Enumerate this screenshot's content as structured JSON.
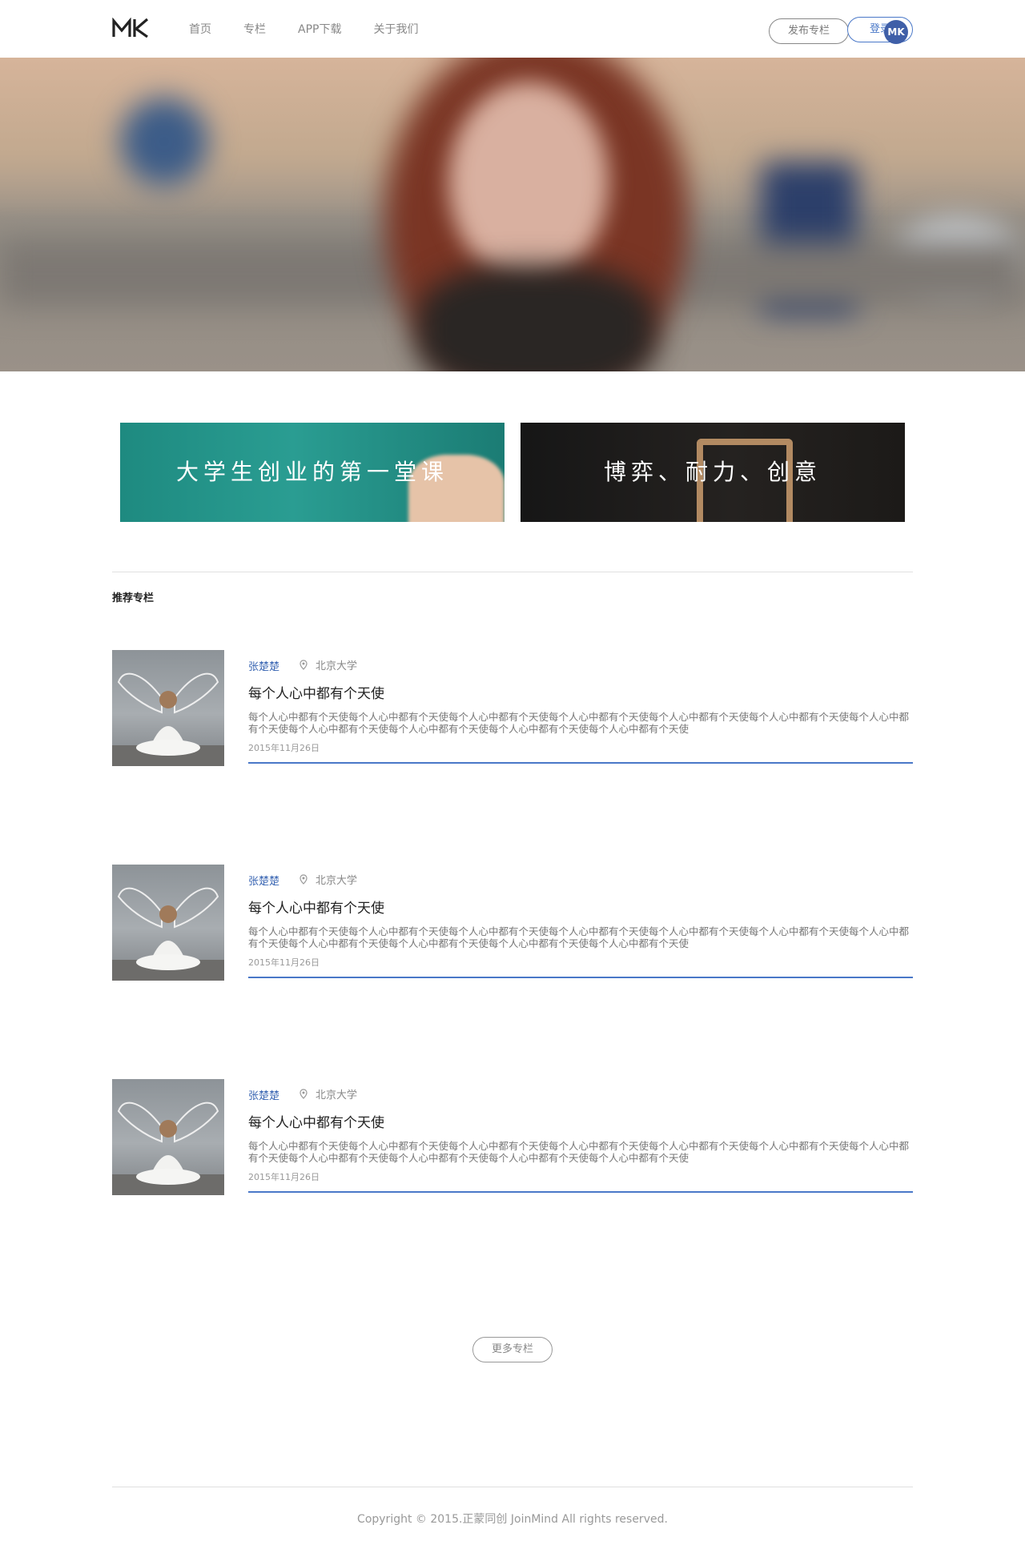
{
  "header": {
    "logo": "MK",
    "nav": [
      "首页",
      "专栏",
      "APP下载",
      "关于我们"
    ],
    "publish_label": "发布专栏",
    "login_label": "登录",
    "avatar_text": "MK",
    "accent_color": "#4a78c8"
  },
  "banners": [
    {
      "title": "大学生创业的第一堂课"
    },
    {
      "title": "博弈、耐力、创意"
    }
  ],
  "section": {
    "title": "推荐专栏"
  },
  "articles": [
    {
      "author": "张楚楚",
      "location": "北京大学",
      "title": "每个人心中都有个天使",
      "desc": "每个人心中都有个天使每个人心中都有个天使每个人心中都有个天使每个人心中都有个天使每个人心中都有个天使每个人心中都有个天使每个人心中都有个天使每个人心中都有个天使每个人心中都有个天使每个人心中都有个天使每个人心中都有个天使",
      "date": "2015年11月26日"
    },
    {
      "author": "张楚楚",
      "location": "北京大学",
      "title": "每个人心中都有个天使",
      "desc": "每个人心中都有个天使每个人心中都有个天使每个人心中都有个天使每个人心中都有个天使每个人心中都有个天使每个人心中都有个天使每个人心中都有个天使每个人心中都有个天使每个人心中都有个天使每个人心中都有个天使每个人心中都有个天使",
      "date": "2015年11月26日"
    },
    {
      "author": "张楚楚",
      "location": "北京大学",
      "title": "每个人心中都有个天使",
      "desc": "每个人心中都有个天使每个人心中都有个天使每个人心中都有个天使每个人心中都有个天使每个人心中都有个天使每个人心中都有个天使每个人心中都有个天使每个人心中都有个天使每个人心中都有个天使每个人心中都有个天使每个人心中都有个天使",
      "date": "2015年11月26日"
    }
  ],
  "more_label": "更多专栏",
  "footer": {
    "copyright": "Copyright © 2015.正蒙同创 JoinMind All rights reserved."
  }
}
